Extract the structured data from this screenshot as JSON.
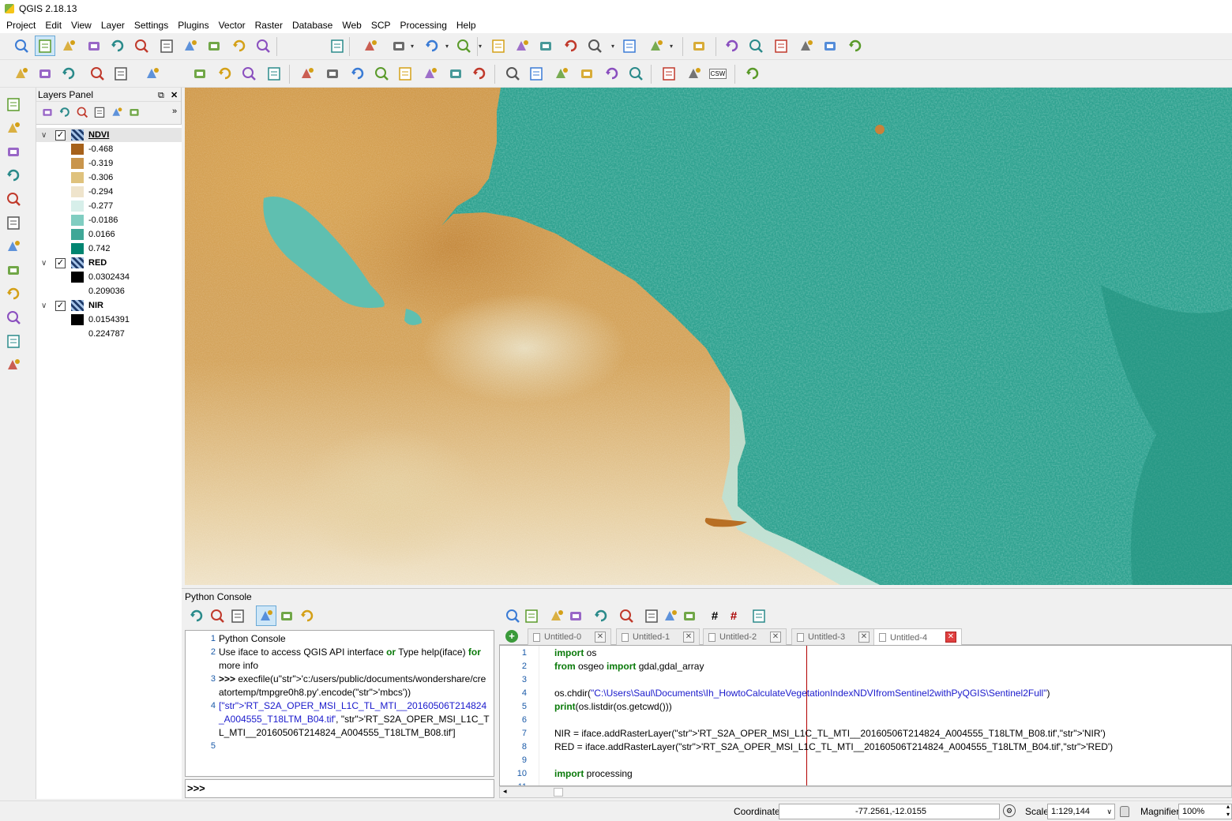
{
  "window": {
    "title": "QGIS 2.18.13"
  },
  "menu": [
    "Project",
    "Edit",
    "View",
    "Layer",
    "Settings",
    "Plugins",
    "Vector",
    "Raster",
    "Database",
    "Web",
    "SCP",
    "Processing",
    "Help"
  ],
  "toolbar": {
    "row1_icons": [
      "pan-to-selection-icon",
      "pan-hand-icon",
      "pan-to-selected-icon",
      "zoom-in-icon",
      "zoom-out-icon",
      "zoom-native-icon",
      "zoom-full-icon",
      "zoom-to-selection-icon",
      "zoom-to-layer-icon",
      "zoom-last-icon",
      "zoom-next-icon",
      "refresh-icon",
      "identify-icon",
      "select-features-icon",
      "select-by-polygon-icon",
      "select-by-expression-icon",
      "deselect-icon",
      "attribute-table-icon",
      "field-calculator-icon",
      "statistics-sum-icon",
      "measure-icon",
      "map-tips-icon",
      "text-annotation-icon",
      "help-icon",
      "new-project-icon",
      "open-project-icon",
      "save-project-icon",
      "save-as-project-icon",
      "new-print-composer-icon",
      "composer-manager-icon"
    ],
    "row2_icons": [
      "current-edits-icon",
      "toggle-editing-icon",
      "save-edits-icon",
      "add-feature-icon",
      "move-feature-icon",
      "node-tool-icon",
      "delete-selected-icon",
      "cut-features-icon",
      "copy-features-icon",
      "paste-features-icon",
      "label-abc-icon",
      "layer-diagram-icon",
      "label-highlight-icon",
      "pin-labels-icon",
      "show-hide-labels-icon",
      "move-label-icon",
      "rotate-label-icon",
      "change-label-icon",
      "scp-band-set-icon",
      "scp-vd-icon",
      "scp-classification-icon",
      "scp-download-icon",
      "scp-preprocessing-icon",
      "scp-database-icon",
      "wms-add-icon",
      "wfs-add-icon",
      "csw-label-icon",
      "python-console-icon"
    ],
    "csw_text": "CSW"
  },
  "layers_panel": {
    "title": "Layers Panel",
    "layers": [
      {
        "name": "NDVI",
        "checked": true,
        "expanded": true,
        "legend": [
          {
            "label": "-0.468",
            "color": "#a6611a"
          },
          {
            "label": "-0.319",
            "color": "#c9954c"
          },
          {
            "label": "-0.306",
            "color": "#dfc27d"
          },
          {
            "label": "-0.294",
            "color": "#efe4cc"
          },
          {
            "label": "-0.277",
            "color": "#d7efea"
          },
          {
            "label": "-0.0186",
            "color": "#80cdc1"
          },
          {
            "label": "0.0166",
            "color": "#3fa797"
          },
          {
            "label": "0.742",
            "color": "#018571"
          }
        ]
      },
      {
        "name": "RED",
        "checked": true,
        "expanded": true,
        "legend": [
          {
            "label": "0.0302434",
            "color": "#000000"
          },
          {
            "label": "0.209036",
            "color": "#ffffff"
          }
        ]
      },
      {
        "name": "NIR",
        "checked": true,
        "expanded": true,
        "legend": [
          {
            "label": "0.0154391",
            "color": "#000000"
          },
          {
            "label": "0.224787",
            "color": "#ffffff"
          }
        ]
      }
    ]
  },
  "python_console": {
    "title": "Python Console",
    "lines": [
      {
        "n": "1",
        "text": "Python Console"
      },
      {
        "n": "2",
        "text": "Use iface to access QGIS API interface or Type help(iface) for more info"
      },
      {
        "n": "3",
        "text": ">>> execfile(u'c:/users/public/documents/wondershare/creatortemp/tmpgre0h8.py'.encode('mbcs'))"
      },
      {
        "n": "4",
        "text": "['RT_S2A_OPER_MSI_L1C_TL_MTI__20160506T214824_A004555_T18LTM_B04.tif', 'RT_S2A_OPER_MSI_L1C_TL_MTI__20160506T214824_A004555_T18LTM_B08.tif']"
      },
      {
        "n": "5",
        "text": ""
      }
    ],
    "prompt": ">>>"
  },
  "editor": {
    "tabs": [
      "Untitled-0",
      "Untitled-1",
      "Untitled-2",
      "Untitled-3",
      "Untitled-4"
    ],
    "active_tab": "Untitled-4",
    "lines": [
      {
        "n": "1",
        "text": "import os"
      },
      {
        "n": "2",
        "text": "from osgeo import gdal,gdal_array"
      },
      {
        "n": "3",
        "text": ""
      },
      {
        "n": "4",
        "text": "os.chdir(\"C:\\Users\\Saul\\Documents\\Ih_HowtoCalculateVegetationIndexNDVIfromSentinel2withPyQGIS\\Sentinel2Full\")"
      },
      {
        "n": "5",
        "text": "print(os.listdir(os.getcwd()))"
      },
      {
        "n": "6",
        "text": ""
      },
      {
        "n": "7",
        "text": "NIR = iface.addRasterLayer('RT_S2A_OPER_MSI_L1C_TL_MTI__20160506T214824_A004555_T18LTM_B08.tif','NIR')"
      },
      {
        "n": "8",
        "text": "RED = iface.addRasterLayer('RT_S2A_OPER_MSI_L1C_TL_MTI__20160506T214824_A004555_T18LTM_B04.tif','RED')"
      },
      {
        "n": "9",
        "text": ""
      },
      {
        "n": "10",
        "text": "import processing"
      }
    ]
  },
  "status": {
    "coordinate_label": "Coordinate",
    "coordinate_value": "-77.2561,-12.0155",
    "scale_label": "Scale",
    "scale_value": "1:129,144",
    "magnifier_label": "Magnifier",
    "magnifier_value": "100%"
  },
  "colors": {
    "ndvi_low": "#a6611a",
    "ndvi_high": "#018571",
    "active_tool": "#cde6f7"
  }
}
